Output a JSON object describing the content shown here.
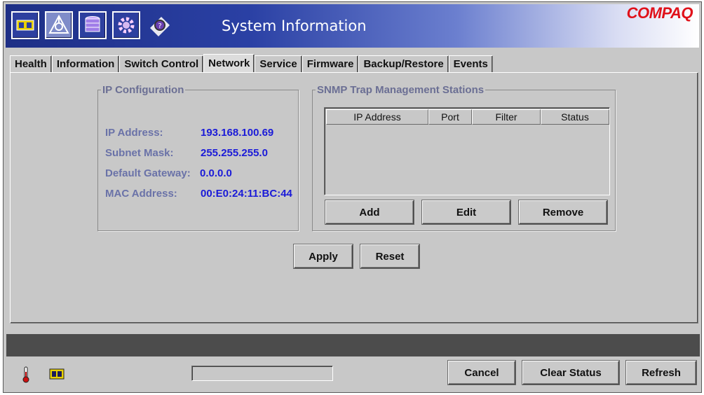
{
  "window": {
    "title": "System Information",
    "brand": "COMPAQ"
  },
  "toolbar_icons": [
    "switch-icon",
    "network-tree-icon",
    "database-icon",
    "settings-gear-icon",
    "help-magnifier-icon"
  ],
  "tabs": [
    {
      "label": "Health",
      "selected": false
    },
    {
      "label": "Information",
      "selected": false
    },
    {
      "label": "Switch Control",
      "selected": false
    },
    {
      "label": "Network",
      "selected": true
    },
    {
      "label": "Service",
      "selected": false
    },
    {
      "label": "Firmware",
      "selected": false
    },
    {
      "label": "Backup/Restore",
      "selected": false
    },
    {
      "label": "Events",
      "selected": false
    }
  ],
  "ip_config": {
    "title": "IP Configuration",
    "ip_label": "IP Address:",
    "ip_value": "193.168.100.69",
    "subnet_label": "Subnet Mask:",
    "subnet_value": "255.255.255.0",
    "gateway_label": "Default Gateway:",
    "gateway_value": "0.0.0.0",
    "mac_label": "MAC Address:",
    "mac_value": "00:E0:24:11:BC:44"
  },
  "snmp": {
    "title": "SNMP Trap Management Stations",
    "columns": [
      "IP Address",
      "Port",
      "Filter",
      "Status"
    ],
    "rows": [],
    "add_label": "Add",
    "edit_label": "Edit",
    "remove_label": "Remove"
  },
  "actions": {
    "apply_label": "Apply",
    "reset_label": "Reset"
  },
  "footer": {
    "status_icons": [
      "thermometer-icon",
      "switch-status-icon"
    ],
    "progress": 0,
    "cancel_label": "Cancel",
    "clear_status_label": "Clear Status",
    "refresh_label": "Refresh"
  },
  "colors": {
    "label": "#6a72a8",
    "value": "#1a1ad8",
    "brand": "#e0111a",
    "titlebar": "#2a40a4"
  }
}
